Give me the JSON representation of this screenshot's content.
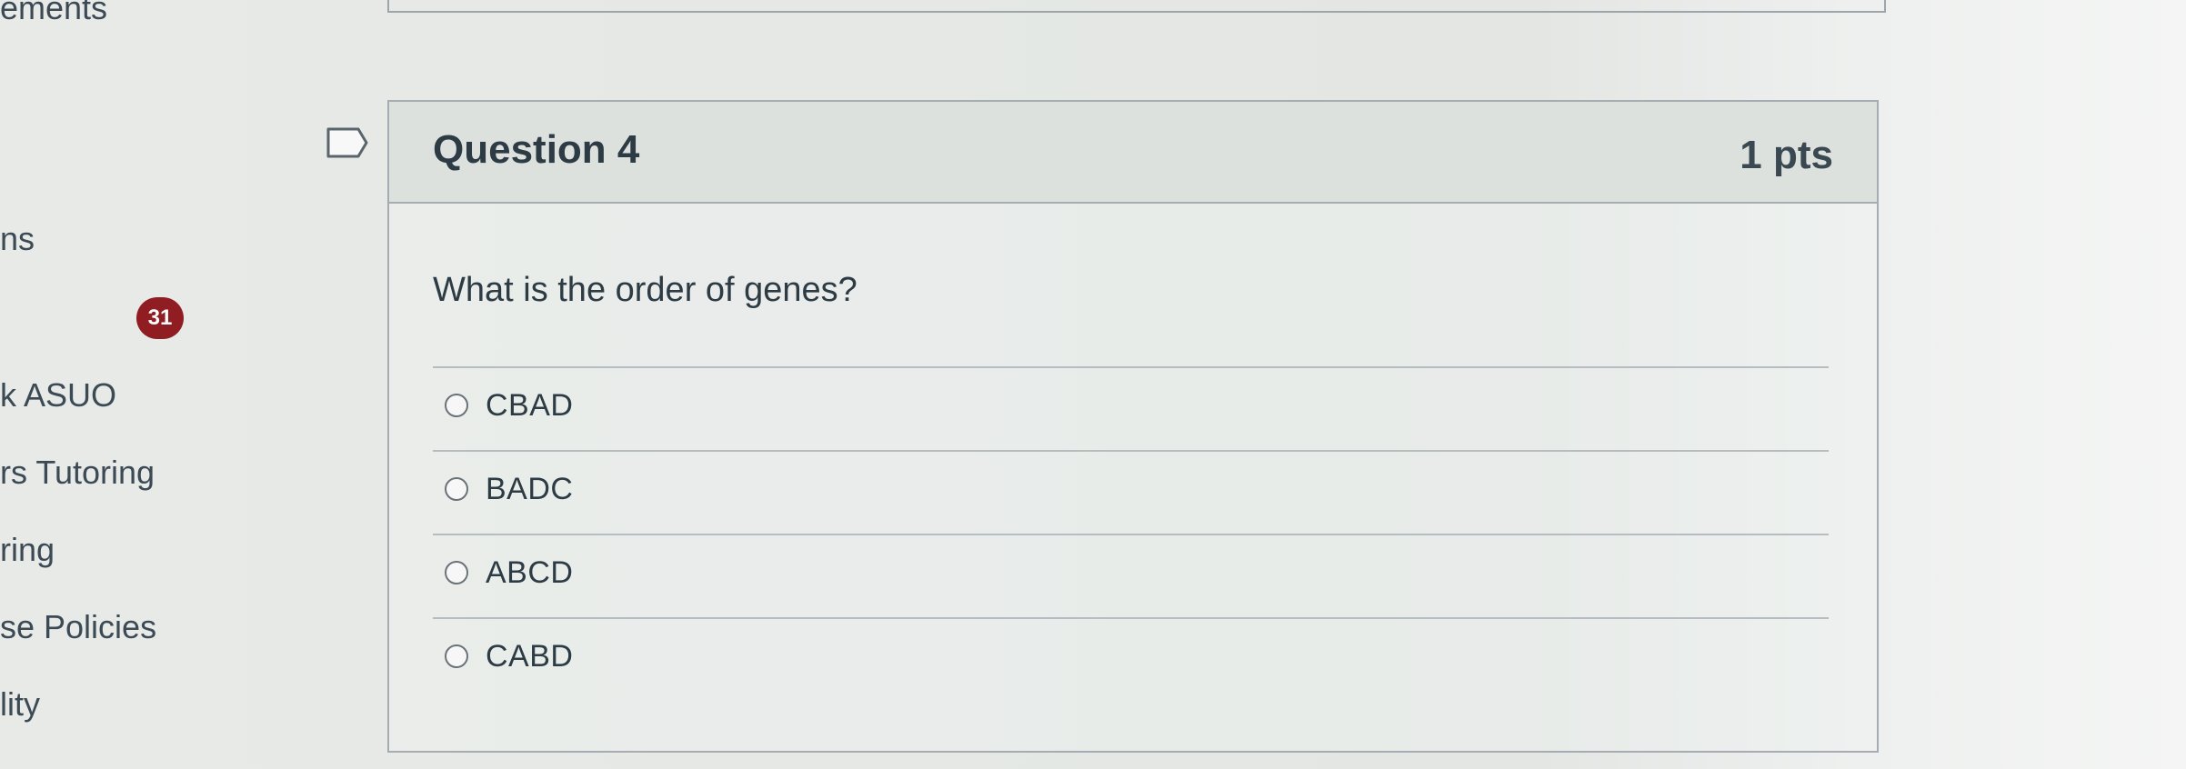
{
  "sidebar": {
    "items": [
      {
        "label": "ements"
      },
      {
        "label": "ns"
      },
      {
        "label": "k ASUO"
      },
      {
        "label": "rs Tutoring"
      },
      {
        "label": "ring"
      },
      {
        "label": "se Policies"
      },
      {
        "label": "lity"
      }
    ],
    "badge": "31"
  },
  "question": {
    "title": "Question 4",
    "points": "1 pts",
    "text": "What is the order of genes?",
    "answers": [
      {
        "label": "CBAD"
      },
      {
        "label": "BADC"
      },
      {
        "label": "ABCD"
      },
      {
        "label": "CABD"
      }
    ]
  },
  "icons": {
    "flag": "bookmark-flag-icon",
    "radio": "radio-circle-icon"
  },
  "colors": {
    "badge": "#8f1d22",
    "border": "#a5adb2",
    "header_bg": "#dde1de",
    "text": "#2d3b45"
  }
}
